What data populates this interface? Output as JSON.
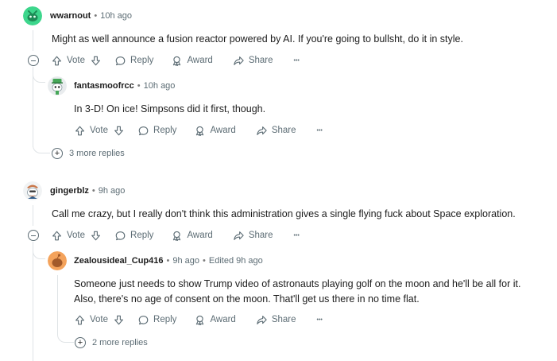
{
  "comments": [
    {
      "author": "wwarnout",
      "time": "10h ago",
      "body": "Might as well announce a fusion reactor powered by AI. If you're going to bullsht, do it in style.",
      "avatar": "snoo-green-avatar",
      "actions": {
        "vote": "Vote",
        "reply": "Reply",
        "award": "Award",
        "share": "Share",
        "more": "•••"
      },
      "replies": [
        {
          "author": "fantasmoofrcc",
          "time": "10h ago",
          "body": "In 3-D! On ice! Simpsons did it first, though.",
          "avatar": "snoo-green-hat-avatar",
          "actions": {
            "vote": "Vote",
            "reply": "Reply",
            "award": "Award",
            "share": "Share",
            "more": "•••"
          }
        }
      ],
      "more_replies": "3 more replies"
    },
    {
      "author": "gingerblz",
      "time": "9h ago",
      "body": "Call me crazy, but I really don't think this administration gives a single flying fuck about Space exploration.",
      "avatar": "snoo-ginger-avatar",
      "actions": {
        "vote": "Vote",
        "reply": "Reply",
        "award": "Award",
        "share": "Share",
        "more": "•••"
      },
      "replies": [
        {
          "author": "Zealousideal_Cup416",
          "time": "9h ago",
          "edited": "Edited 9h ago",
          "body_lines": [
            "Someone just needs to show Trump video of astronauts playing golf on the moon and he'll be all for it.",
            "Also, there's no age of consent on the moon. That'll get us there in no time flat."
          ],
          "avatar": "snoo-orange-avatar",
          "actions": {
            "vote": "Vote",
            "reply": "Reply",
            "award": "Award",
            "share": "Share",
            "more": "•••"
          }
        }
      ],
      "more_replies": "2 more replies"
    }
  ],
  "colors": {
    "text": "#1c1c1c",
    "muted": "#5c6c74",
    "thread_line": "#dfe3e6",
    "avatar_green": "#3dd68c",
    "avatar_orange": "#f4a35c"
  }
}
